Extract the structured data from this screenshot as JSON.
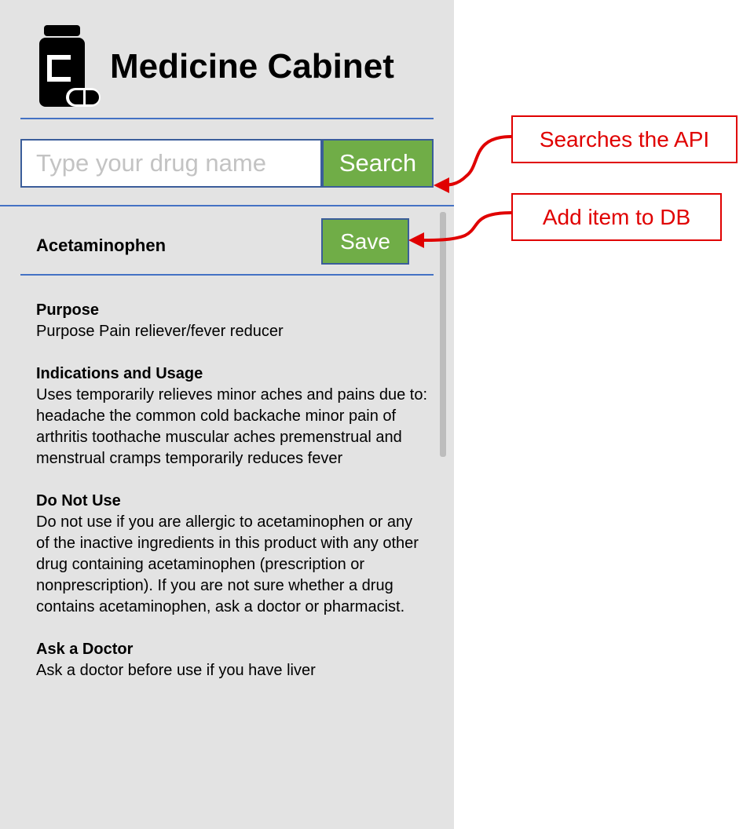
{
  "header": {
    "app_title": "Medicine Cabinet",
    "logo_icon": "medicine-bottle-icon"
  },
  "search": {
    "placeholder": "Type your drug name",
    "value": "",
    "button_label": "Search"
  },
  "result": {
    "drug_name": "Acetaminophen",
    "save_label": "Save",
    "sections": [
      {
        "heading": "Purpose",
        "body": "Purpose Pain reliever/fever reducer"
      },
      {
        "heading": "Indications and Usage",
        "body": "Uses temporarily relieves minor aches and pains due to: headache the common cold backache minor pain of arthritis toothache muscular aches premenstrual and menstrual cramps temporarily reduces fever"
      },
      {
        "heading": "Do Not Use",
        "body": "Do not use if you are allergic to acetaminophen or any of the inactive ingredients in this product with any other drug containing acetaminophen (prescription or nonprescription). If you are not sure whether a drug contains acetaminophen, ask a doctor or pharmacist."
      },
      {
        "heading": "Ask a Doctor",
        "body": "Ask a doctor before use if you have liver"
      }
    ]
  },
  "annotations": {
    "search_callout": "Searches the API",
    "save_callout": "Add item to DB"
  },
  "colors": {
    "panel_bg": "#e3e3e3",
    "button_green": "#70ad47",
    "rule_blue": "#4472c4",
    "callout_red": "#e00000"
  }
}
